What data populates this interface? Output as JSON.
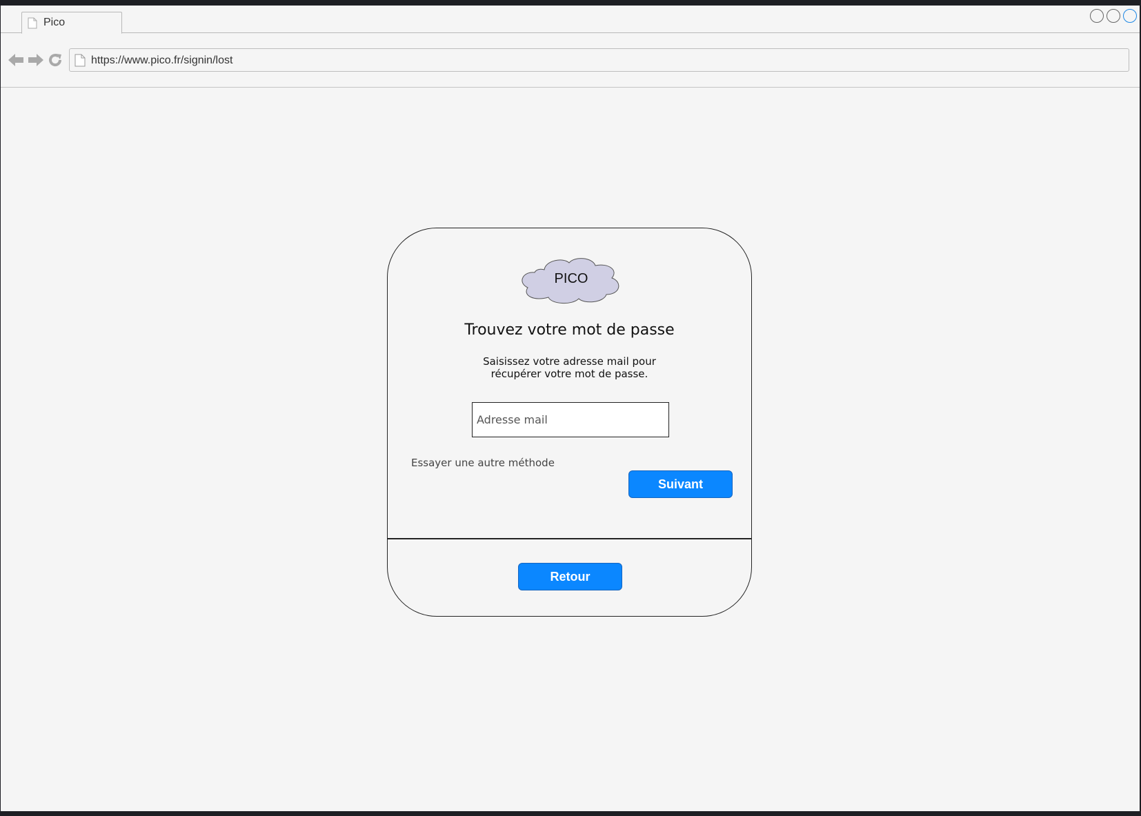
{
  "browser": {
    "tab_title": "Pico",
    "url": "https://www.pico.fr/signin/lost",
    "nav_icons": [
      "back-arrow-icon",
      "forward-arrow-icon",
      "reload-icon"
    ],
    "window_buttons": [
      "minimize-button",
      "maximize-button",
      "close-button"
    ]
  },
  "card": {
    "logo_text": "PICO",
    "title": "Trouvez votre mot de passe",
    "subtitle_line1": "Saisissez votre adresse mail pour",
    "subtitle_line2": "récupérer votre mot de passe.",
    "email_placeholder": "Adresse mail",
    "email_value": "",
    "alt_method_link": "Essayer une autre méthode",
    "next_button": "Suivant",
    "back_button": "Retour"
  },
  "colors": {
    "page_background": "#f5f5f5",
    "button_blue": "#0b87ff",
    "logo_cloud_fill": "#d0cfe4"
  }
}
